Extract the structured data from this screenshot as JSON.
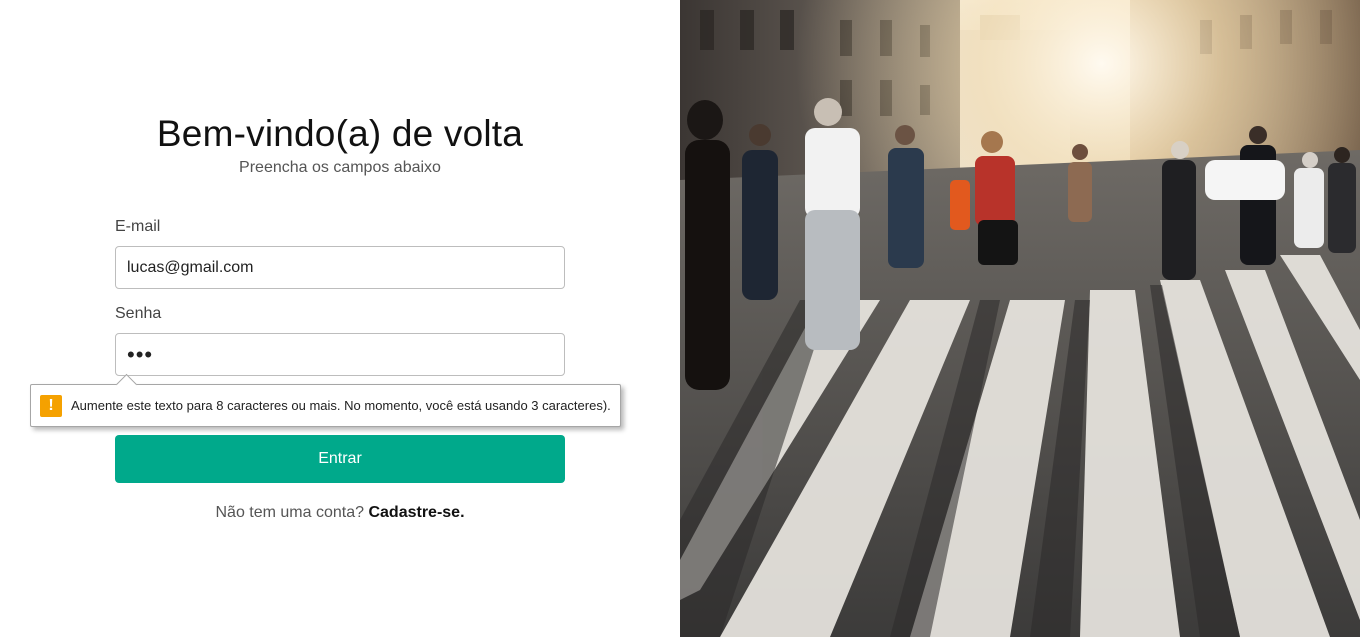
{
  "login": {
    "title": "Bem-vindo(a) de volta",
    "subtitle": "Preencha os campos abaixo",
    "email_label": "E-mail",
    "email_value": "lucas@gmail.com",
    "password_label": "Senha",
    "password_value": "•••",
    "submit_label": "Entrar",
    "signup_prompt": "Não tem uma conta?",
    "signup_link": "Cadastre-se."
  },
  "validation_tooltip": {
    "icon": "warning-icon",
    "icon_glyph": "!",
    "message": "Aumente este texto para 8 caracteres ou mais. No momento, você está usando 3 caracteres)."
  },
  "photo": {
    "subject": "street-crosswalk-pedestrians-photo"
  },
  "colors": {
    "accent": "#00a98b",
    "warning": "#f5a100"
  }
}
